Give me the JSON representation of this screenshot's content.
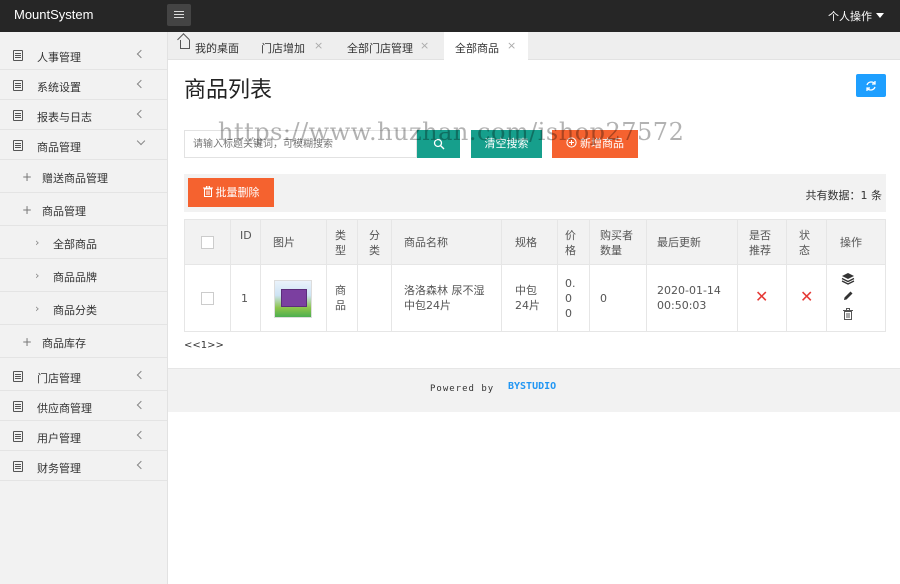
{
  "app": {
    "brand": "MountSystem",
    "user_menu": "个人操作"
  },
  "sidebar": {
    "items": [
      {
        "label": "人事管理",
        "icon": "document-icon"
      },
      {
        "label": "系统设置",
        "icon": "document-icon"
      },
      {
        "label": "报表与日志",
        "icon": "document-icon"
      },
      {
        "label": "商品管理",
        "icon": "document-icon",
        "expanded": true
      },
      {
        "label": "门店管理",
        "icon": "document-icon"
      },
      {
        "label": "供应商管理",
        "icon": "document-icon"
      },
      {
        "label": "用户管理",
        "icon": "document-icon"
      },
      {
        "label": "财务管理",
        "icon": "document-icon"
      }
    ],
    "sub_items": [
      "赠送商品管理",
      "商品管理",
      "商品库存"
    ],
    "sub2_items": [
      "全部商品",
      "商品品牌",
      "商品分类"
    ],
    "sub_prefix": "+",
    "sub2_prefix": "›"
  },
  "tabs": [
    {
      "label": "我的桌面",
      "closable": false
    },
    {
      "label": "门店增加",
      "closable": true
    },
    {
      "label": "全部门店管理",
      "closable": true
    },
    {
      "label": "全部商品",
      "closable": true,
      "active": true
    }
  ],
  "tab_close": "×",
  "main": {
    "title": "商品列表",
    "search_placeholder": "请输入标题关键词，可模糊搜索",
    "clear_label": "清空搜索",
    "add_label": "新增商品",
    "batch_delete_label": "批量删除",
    "total_text": "共有数据：1 条",
    "watermark": "https://www.huzhan.com/ishop27572"
  },
  "table": {
    "columns": [
      "ID",
      "图片",
      "类型",
      "分类",
      "商品名称",
      "规格",
      "价格",
      "购买者数量",
      "最后更新",
      "是否推荐",
      "状态",
      "操作"
    ],
    "rows": [
      {
        "id": "1",
        "type": "商品",
        "category": "",
        "name": "洛洛森林 尿不湿中包24片",
        "spec": "中包24片",
        "price": "0.00",
        "buyers": "0",
        "updated": "2020-01-14 00:50:03",
        "recommended": false,
        "status": false
      }
    ],
    "cross_mark": "✕"
  },
  "pager": "<<1>>",
  "footer": {
    "powered": "Powered by",
    "studio": "BYSTUDIO"
  },
  "colors": {
    "topbar": "#262626",
    "green": "#169f8c",
    "orange": "#f5622f",
    "blue": "#1e9fff",
    "red": "#e53935"
  }
}
